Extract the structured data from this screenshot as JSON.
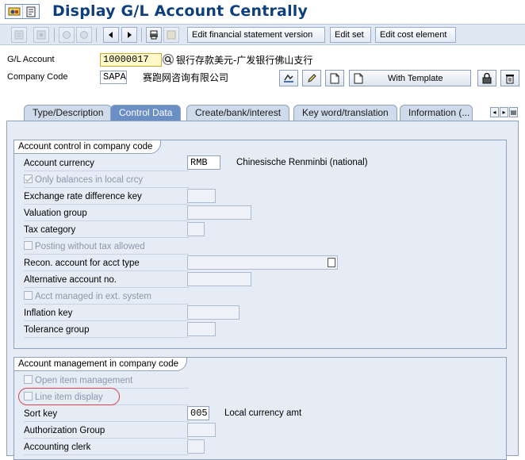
{
  "window": {
    "title": "Display G/L Account Centrally"
  },
  "toolbar": {
    "edit_fs_version": "Edit financial statement version",
    "edit_set": "Edit set",
    "edit_cost_element": "Edit cost element"
  },
  "header": {
    "gl_account_label": "G/L Account",
    "gl_account_value": "10000017",
    "gl_account_desc": "银行存款美元-广发银行佛山支行",
    "company_code_label": "Company Code",
    "company_code_value": "SAPA",
    "company_name": "赛跑网咨询有限公司",
    "with_template_label": "With Template"
  },
  "tabs": [
    {
      "label": "Type/Description"
    },
    {
      "label": "Control Data"
    },
    {
      "label": "Create/bank/interest"
    },
    {
      "label": "Key word/translation"
    },
    {
      "label": "Information (..."
    }
  ],
  "active_tab": "Control Data",
  "account_control": {
    "title": "Account control in company code",
    "account_currency_label": "Account currency",
    "account_currency_value": "RMB",
    "account_currency_desc": "Chinesische Renminbi (national)",
    "only_balances_label": "Only balances in local crcy",
    "only_balances_checked": true,
    "exchange_rate_label": "Exchange rate difference key",
    "valuation_group_label": "Valuation group",
    "tax_category_label": "Tax category",
    "posting_without_tax_label": "Posting without tax allowed",
    "posting_without_tax_checked": false,
    "recon_account_label": "Recon. account for acct type",
    "alternative_account_label": "Alternative account no.",
    "acct_managed_label": "Acct managed in ext. system",
    "acct_managed_checked": false,
    "inflation_key_label": "Inflation key",
    "tolerance_group_label": "Tolerance group"
  },
  "account_management": {
    "title": "Account management in company code",
    "open_item_label": "Open item management",
    "open_item_checked": false,
    "line_item_label": "Line item display",
    "line_item_checked": false,
    "sort_key_label": "Sort key",
    "sort_key_value": "005",
    "sort_key_desc": "Local currency amt",
    "authorization_group_label": "Authorization Group",
    "accounting_clerk_label": "Accounting clerk"
  },
  "colors": {
    "title_blue": "#0d3f7d",
    "active_tab": "#6b8fc4",
    "pane_background": "#e5ecf5",
    "highlight_red": "#e0424a",
    "required_field_yellow": "#fff8c8"
  }
}
